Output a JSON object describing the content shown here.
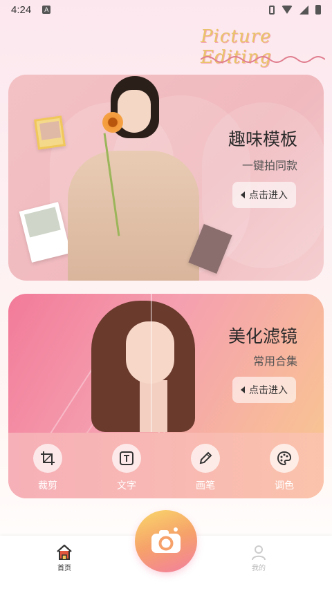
{
  "status": {
    "time": "4:24",
    "notif_icon": "a-icon"
  },
  "brand": {
    "text": "Picture Editing"
  },
  "cards": [
    {
      "title": "趣味模板",
      "subtitle": "一键拍同款",
      "button": "点击进入"
    },
    {
      "title": "美化滤镜",
      "subtitle": "常用合集",
      "button": "点击进入"
    }
  ],
  "tools": [
    {
      "label": "裁剪",
      "icon": "crop-icon"
    },
    {
      "label": "文字",
      "icon": "text-icon"
    },
    {
      "label": "画笔",
      "icon": "pen-icon"
    },
    {
      "label": "调色",
      "icon": "palette-icon"
    }
  ],
  "nav": {
    "home": "首页",
    "me": "我的"
  },
  "colors": {
    "home_active": "#e3563e",
    "me_inactive": "#cccccc"
  }
}
